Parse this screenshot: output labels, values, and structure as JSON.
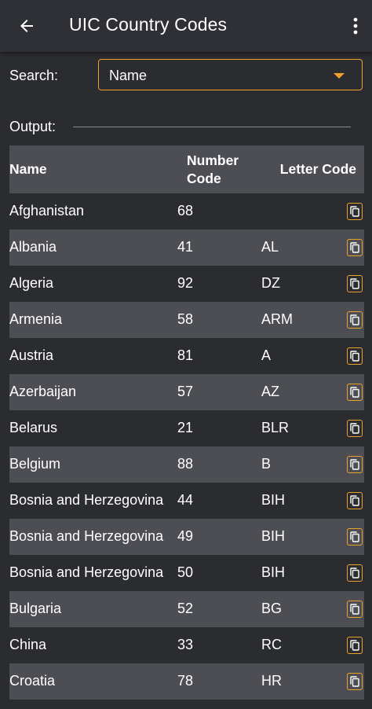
{
  "appbar": {
    "title": "UIC Country Codes"
  },
  "search": {
    "label": "Search:",
    "selected": "Name"
  },
  "output": {
    "label": "Output:"
  },
  "table": {
    "headers": {
      "name": "Name",
      "number_line1": "Number",
      "number_line2": "Code",
      "letter": "Letter Code"
    },
    "rows": [
      {
        "name": "Afghanistan",
        "number": "68",
        "letter": ""
      },
      {
        "name": "Albania",
        "number": "41",
        "letter": "AL"
      },
      {
        "name": "Algeria",
        "number": "92",
        "letter": "DZ"
      },
      {
        "name": "Armenia",
        "number": "58",
        "letter": "ARM"
      },
      {
        "name": "Austria",
        "number": "81",
        "letter": "A"
      },
      {
        "name": "Azerbaijan",
        "number": "57",
        "letter": "AZ"
      },
      {
        "name": "Belarus",
        "number": "21",
        "letter": "BLR"
      },
      {
        "name": "Belgium",
        "number": "88",
        "letter": "B"
      },
      {
        "name": "Bosnia and Herzegovina",
        "number": "44",
        "letter": "BIH"
      },
      {
        "name": "Bosnia and Herzegovina",
        "number": "49",
        "letter": "BIH"
      },
      {
        "name": "Bosnia and Herzegovina",
        "number": "50",
        "letter": "BIH"
      },
      {
        "name": "Bulgaria",
        "number": "52",
        "letter": "BG"
      },
      {
        "name": "China",
        "number": "33",
        "letter": "RC"
      },
      {
        "name": "Croatia",
        "number": "78",
        "letter": "HR"
      }
    ]
  },
  "icons": {
    "back": "arrow-left-icon",
    "menu": "more-vertical-icon",
    "copy": "copy-icon",
    "dropdown": "caret-down-icon"
  },
  "colors": {
    "accent": "#f0a02a",
    "background": "#2b2c30",
    "appbar": "#2f3035",
    "stripe": "#4d4e54"
  }
}
